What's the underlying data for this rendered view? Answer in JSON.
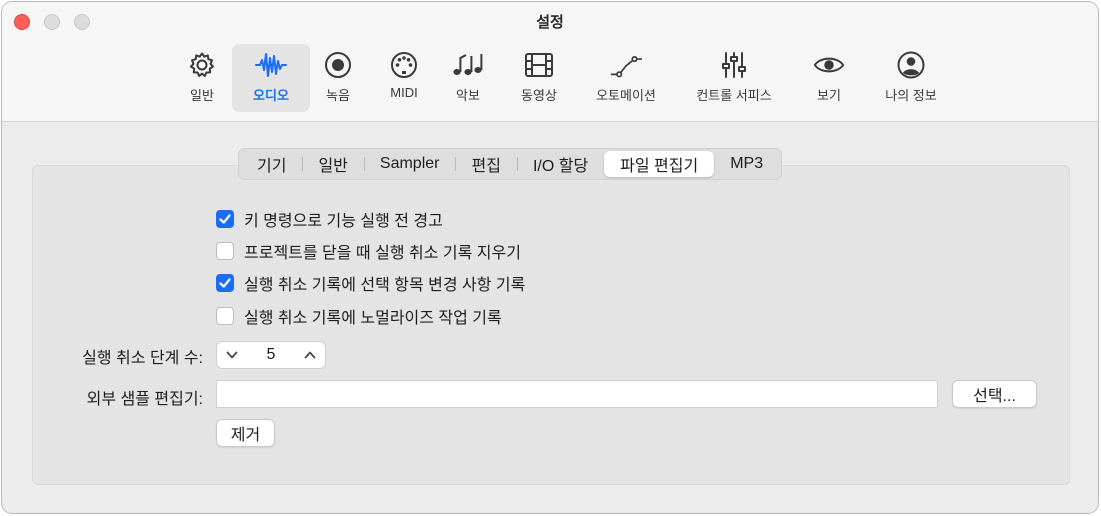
{
  "window": {
    "title": "설정",
    "accent_color": "#1a6ef5",
    "close_color": "#ff5f57"
  },
  "toolbar": {
    "items": [
      {
        "label": "일반",
        "icon": "gear-icon",
        "active": false
      },
      {
        "label": "오디오",
        "icon": "waveform-icon",
        "active": true
      },
      {
        "label": "녹음",
        "icon": "record-icon",
        "active": false
      },
      {
        "label": "MIDI",
        "icon": "midi-port-icon",
        "active": false
      },
      {
        "label": "악보",
        "icon": "music-notes-icon",
        "active": false
      },
      {
        "label": "동영상",
        "icon": "film-icon",
        "active": false
      },
      {
        "label": "오토메이션",
        "icon": "automation-curve-icon",
        "active": false
      },
      {
        "label": "컨트롤 서피스",
        "icon": "sliders-icon",
        "active": false
      },
      {
        "label": "보기",
        "icon": "eye-icon",
        "active": false
      },
      {
        "label": "나의 정보",
        "icon": "person-icon",
        "active": false
      }
    ]
  },
  "tabs": {
    "items": [
      "기기",
      "일반",
      "Sampler",
      "편집",
      "I/O 할당",
      "파일 편집기",
      "MP3"
    ],
    "selected": "파일 편집기"
  },
  "options": {
    "items": [
      {
        "label": "키 명령으로 기능 실행 전 경고",
        "checked": true
      },
      {
        "label": "프로젝트를 닫을 때 실행 취소 기록 지우기",
        "checked": false
      },
      {
        "label": "실행 취소 기록에 선택 항목 변경 사항 기록",
        "checked": true
      },
      {
        "label": "실행 취소 기록에 노멀라이즈 작업 기록",
        "checked": false
      }
    ]
  },
  "undo_steps": {
    "label": "실행 취소 단계 수:",
    "value": "5"
  },
  "external_editor": {
    "label": "외부 샘플 편집기:",
    "value": "",
    "choose_label": "선택...",
    "remove_label": "제거"
  }
}
